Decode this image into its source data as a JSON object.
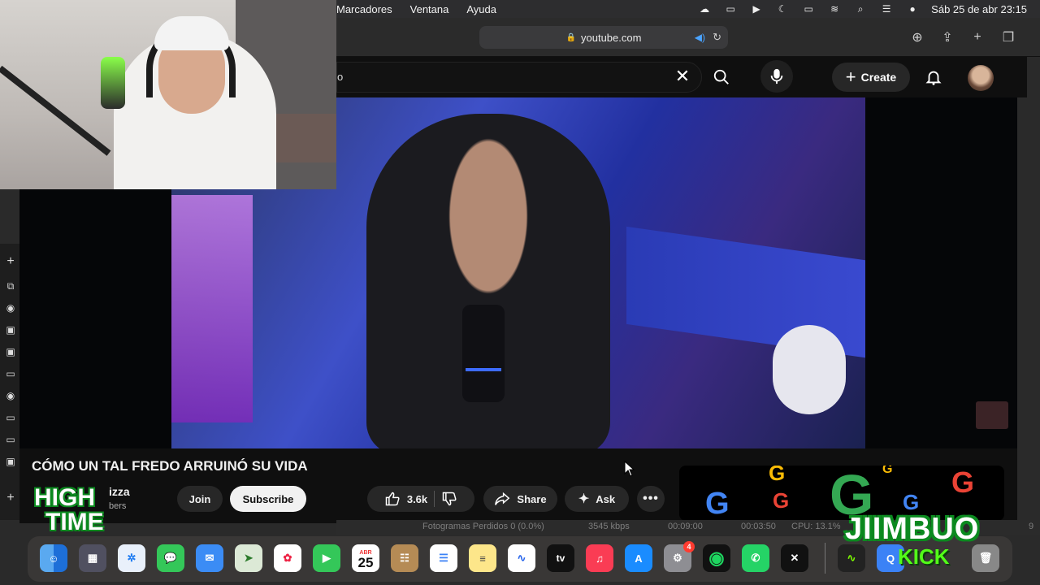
{
  "menubar": {
    "menus": [
      "Marcadores",
      "Ventana",
      "Ayuda"
    ],
    "datetime": "Sáb 25 de abr  23:15"
  },
  "browser": {
    "url": "youtube.com"
  },
  "youtube": {
    "search_value": "o",
    "create_label": "Create"
  },
  "video": {
    "title": "CÓMO UN TAL FREDO ARRUINÓ SU VIDA",
    "channel_name": "izza",
    "subscribers": "bers",
    "join_label": "Join",
    "subscribe_label": "Subscribe",
    "likes": "3.6k",
    "share_label": "Share",
    "ask_label": "Ask"
  },
  "obs": {
    "frames_dropped": "Fotogramas Perdidos 0 (0.0%)",
    "bitrate": "3545 kbps",
    "rec_time": "00:09:00",
    "stream_time": "00:03:50",
    "cpu": "CPU: 13.1%",
    "fps": "9"
  },
  "dock": {
    "calendar_month": "ABR",
    "calendar_day": "25",
    "settings_badge": "4",
    "tv_label": "tv"
  },
  "overlays": {
    "high_line1": "HIGH",
    "high_line2": "TIME",
    "streamer": "JIIMBUO",
    "platform": "KICK"
  },
  "colors": {
    "yt_bg": "#0f0f0f",
    "pill": "#272727",
    "kick_green": "#53fc18"
  }
}
